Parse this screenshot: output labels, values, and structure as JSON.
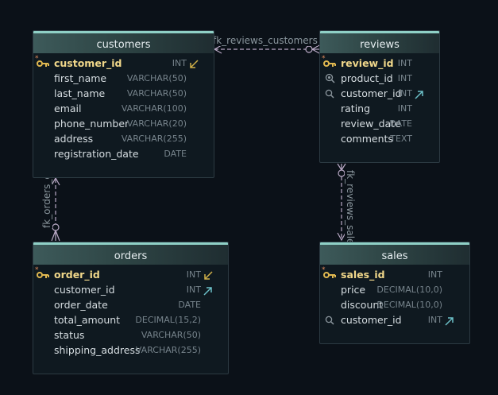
{
  "colors": {
    "background": "#0b1118",
    "header_accent": "#8fd0c6",
    "primary_key": "#f0d78a",
    "key_icon": "#e0b850",
    "relation_line": "#b8a8c4",
    "fk_in_arrow": "#d0b048",
    "fk_out_arrow": "#6cc0c8"
  },
  "tables": [
    {
      "name": "customers",
      "columns": [
        {
          "name": "customer_id",
          "type": "INT",
          "pk": true,
          "icon": "key-icon",
          "fk_arrow": "in"
        },
        {
          "name": "first_name",
          "type": "VARCHAR(50)"
        },
        {
          "name": "last_name",
          "type": "VARCHAR(50)"
        },
        {
          "name": "email",
          "type": "VARCHAR(100)"
        },
        {
          "name": "phone_number",
          "type": "VARCHAR(20)"
        },
        {
          "name": "address",
          "type": "VARCHAR(255)"
        },
        {
          "name": "registration_date",
          "type": "DATE"
        }
      ]
    },
    {
      "name": "reviews",
      "columns": [
        {
          "name": "review_id",
          "type": "INT",
          "pk": true,
          "icon": "key-icon"
        },
        {
          "name": "product_id",
          "type": "INT",
          "icon": "indexed-search-icon"
        },
        {
          "name": "customer_id",
          "type": "INT",
          "icon": "search-icon",
          "fk_arrow": "out"
        },
        {
          "name": "rating",
          "type": "INT"
        },
        {
          "name": "review_date",
          "type": "DATE"
        },
        {
          "name": "comments",
          "type": "TEXT"
        }
      ]
    },
    {
      "name": "orders",
      "columns": [
        {
          "name": "order_id",
          "type": "INT",
          "pk": true,
          "icon": "key-icon",
          "fk_arrow": "in"
        },
        {
          "name": "customer_id",
          "type": "INT",
          "fk_arrow": "out"
        },
        {
          "name": "order_date",
          "type": "DATE"
        },
        {
          "name": "total_amount",
          "type": "DECIMAL(15,2)"
        },
        {
          "name": "status",
          "type": "VARCHAR(50)"
        },
        {
          "name": "shipping_address",
          "type": "VARCHAR(255)"
        }
      ]
    },
    {
      "name": "sales",
      "columns": [
        {
          "name": "sales_id",
          "type": "INT",
          "pk": true,
          "icon": "key-icon"
        },
        {
          "name": "price",
          "type": "DECIMAL(10,0)"
        },
        {
          "name": "discount",
          "type": "DECIMAL(10,0)"
        },
        {
          "name": "customer_id",
          "type": "INT",
          "icon": "search-icon",
          "fk_arrow": "out"
        }
      ]
    }
  ],
  "relationships": [
    {
      "label": "fk_reviews_customers",
      "from": "reviews",
      "to": "customers"
    },
    {
      "label": "fk_orders_c",
      "from": "orders",
      "to": "customers"
    },
    {
      "label": "fk_reviews_sale",
      "from": "reviews",
      "to": "sales"
    }
  ]
}
